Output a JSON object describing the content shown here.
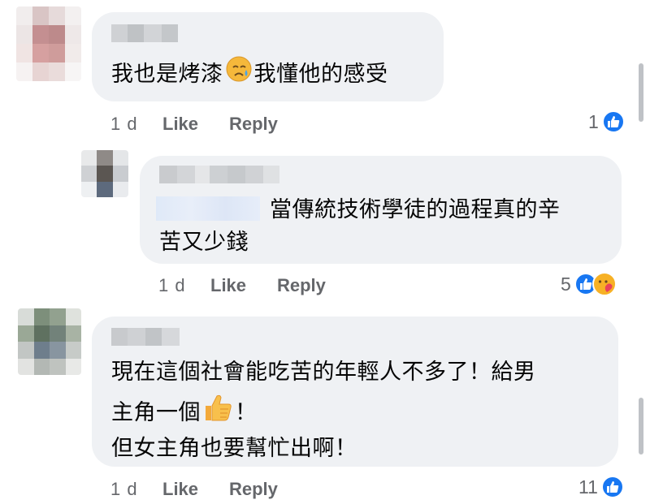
{
  "comments": [
    {
      "text_before_emoji": "我也是烤漆",
      "emoji": "crying-face",
      "text_after_emoji": "我懂他的感受",
      "time": "1 d",
      "like_label": "Like",
      "reply_label": "Reply",
      "reaction_count": "1"
    },
    {
      "line1": "當傳統技術學徒的過程真的辛",
      "line2": "苦又少錢",
      "time": "1 d",
      "like_label": "Like",
      "reply_label": "Reply",
      "reaction_count": "5"
    },
    {
      "line1": "現在這個社會能吃苦的年輕人不多了！給男",
      "line2_before_emoji": "主角一個",
      "emoji": "thumbs-up",
      "line2_after_emoji": "！",
      "line3": "但女主角也要幫忙出啊！",
      "time": "1 d",
      "like_label": "Like",
      "reply_label": "Reply",
      "reaction_count": "11"
    }
  ],
  "colors": {
    "bubble": "#eff1f4",
    "meta": "#65676b",
    "like_blue": "#1877f2",
    "care_yellow": "#f7b125"
  }
}
